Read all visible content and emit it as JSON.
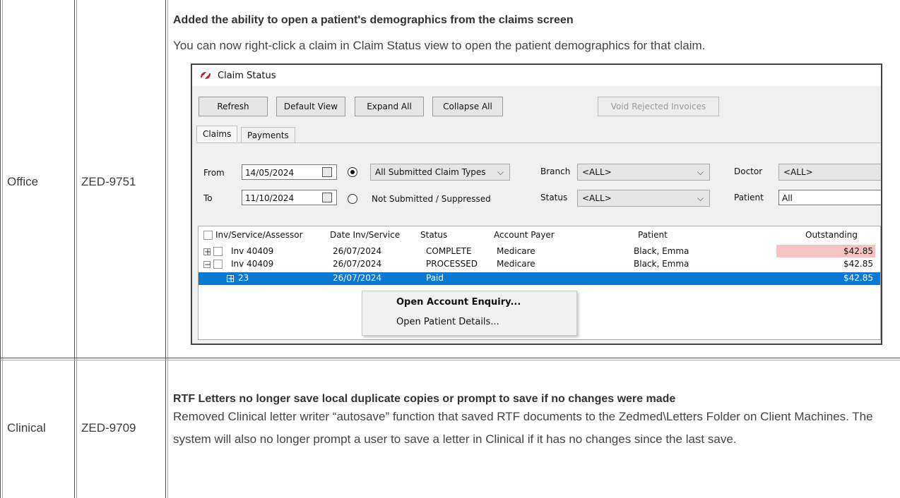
{
  "rows": [
    {
      "area": "Office",
      "ticket": "ZED-9751",
      "heading": "Added the ability to open a patient's demographics from the claims screen",
      "description": "You can now right-click a claim in Claim Status view to open the patient demographics for that claim."
    },
    {
      "area": "Clinical",
      "ticket": "ZED-9709",
      "heading": "RTF Letters no longer save local duplicate copies or prompt to save if no changes were made",
      "description": "Removed Clinical letter writer “autosave” function that saved RTF documents to the  Zedmed\\Letters Folder on Client Machines. The system will also no longer prompt a user to save a letter in Clinical if it has no changes since the last save."
    }
  ],
  "screenshot": {
    "window_title": "Claim Status",
    "buttons": {
      "refresh": "Refresh",
      "default_view": "Default View",
      "expand_all": "Expand All",
      "collapse_all": "Collapse All",
      "void_rejected": "Void Rejected Invoices"
    },
    "tabs": {
      "claims": "Claims",
      "payments": "Payments"
    },
    "filters": {
      "from_label": "From",
      "from_value": "14/05/2024",
      "to_label": "To",
      "to_value": "11/10/2024",
      "claim_type_option": "All Submitted Claim Types",
      "not_submitted_option": "Not Submitted / Suppressed",
      "branch_label": "Branch",
      "branch_value": "<ALL>",
      "status_label": "Status",
      "status_value": "<ALL>",
      "doctor_label": "Doctor",
      "doctor_value": "<ALL>",
      "patient_label": "Patient",
      "patient_value": "All"
    },
    "grid": {
      "columns": [
        "Inv/Service/Assessor",
        "Date Inv/Service",
        "Status",
        "Account Payer",
        "Patient",
        "Outstanding"
      ],
      "rows": [
        {
          "expander": "+",
          "inv": "Inv 40409",
          "date": "26/07/2024",
          "status": "COMPLETE",
          "payer": "Medicare",
          "patient": "Black, Emma",
          "outstanding": "$42.85"
        },
        {
          "expander": "−",
          "inv": "Inv 40409",
          "date": "26/07/2024",
          "status": "PROCESSED",
          "payer": "Medicare",
          "patient": "Black, Emma",
          "outstanding": "$42.85"
        },
        {
          "expander": "+",
          "inv": "23",
          "date": "26/07/2024",
          "status": "Paid",
          "payer": "",
          "patient": "",
          "outstanding": "$42.85"
        }
      ]
    },
    "context_menu": {
      "item1": "Open Account Enquiry...",
      "item2": "Open Patient Details..."
    }
  }
}
